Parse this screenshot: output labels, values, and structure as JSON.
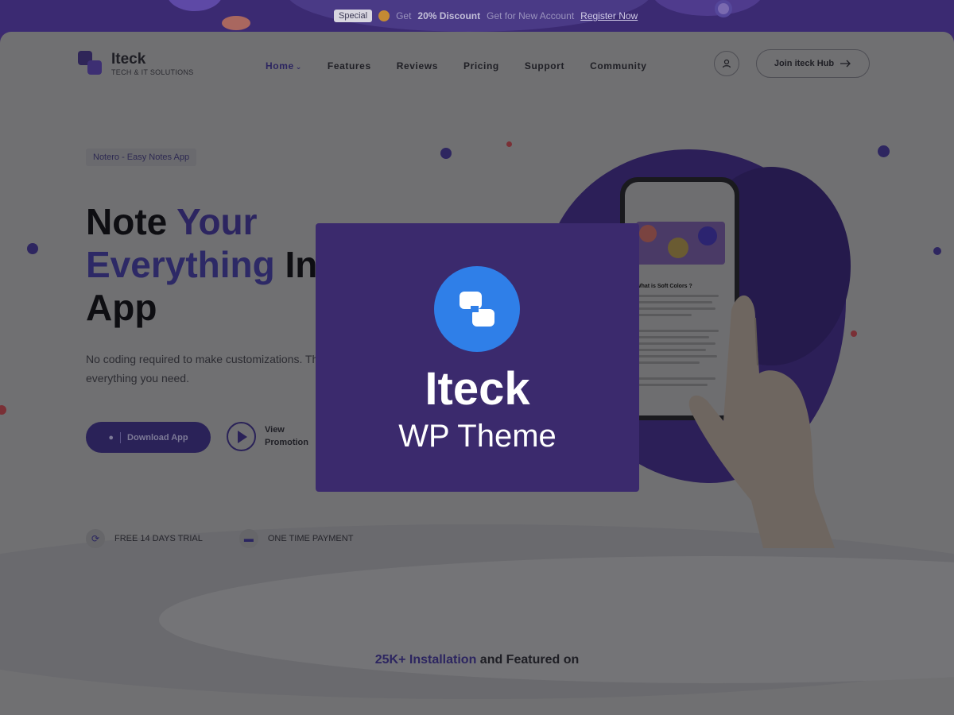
{
  "promo": {
    "badge": "Special",
    "text_pre": "Get",
    "discount": "20% Discount",
    "text_post": "Get for New Account",
    "link": "Register Now"
  },
  "brand": {
    "name": "Iteck",
    "tagline": "TECH & IT SOLUTIONS"
  },
  "nav": {
    "items": [
      "Home",
      "Features",
      "Reviews",
      "Pricing",
      "Support",
      "Community"
    ],
    "active": "Home"
  },
  "header": {
    "cta": "Join iteck Hub"
  },
  "hero": {
    "pill": "Notero - Easy Notes App",
    "headline": {
      "w1": "Note ",
      "w2": "Your",
      "w3": "Everything",
      "w4": " In One",
      "w5": "App"
    },
    "subtitle": "No coding required to make customizations. The live customizer has everything you need.",
    "download_label": "Download App",
    "view_label_1": "View",
    "view_label_2": "Promotion"
  },
  "features": [
    {
      "label": "FREE 14 DAYS TRIAL",
      "icon": "refresh-icon"
    },
    {
      "label": "ONE TIME PAYMENT",
      "icon": "card-icon"
    }
  ],
  "installs": {
    "highlight": "25K+ Installation",
    "rest": " and Featured on"
  },
  "phone": {
    "title": "What is Soft Colors ?"
  },
  "overlay": {
    "title": "Iteck",
    "subtitle": "WP Theme"
  },
  "colors": {
    "accent": "#3b2a6d",
    "logo_blue": "#2f7fe8",
    "primary_button": "#2a2258"
  }
}
